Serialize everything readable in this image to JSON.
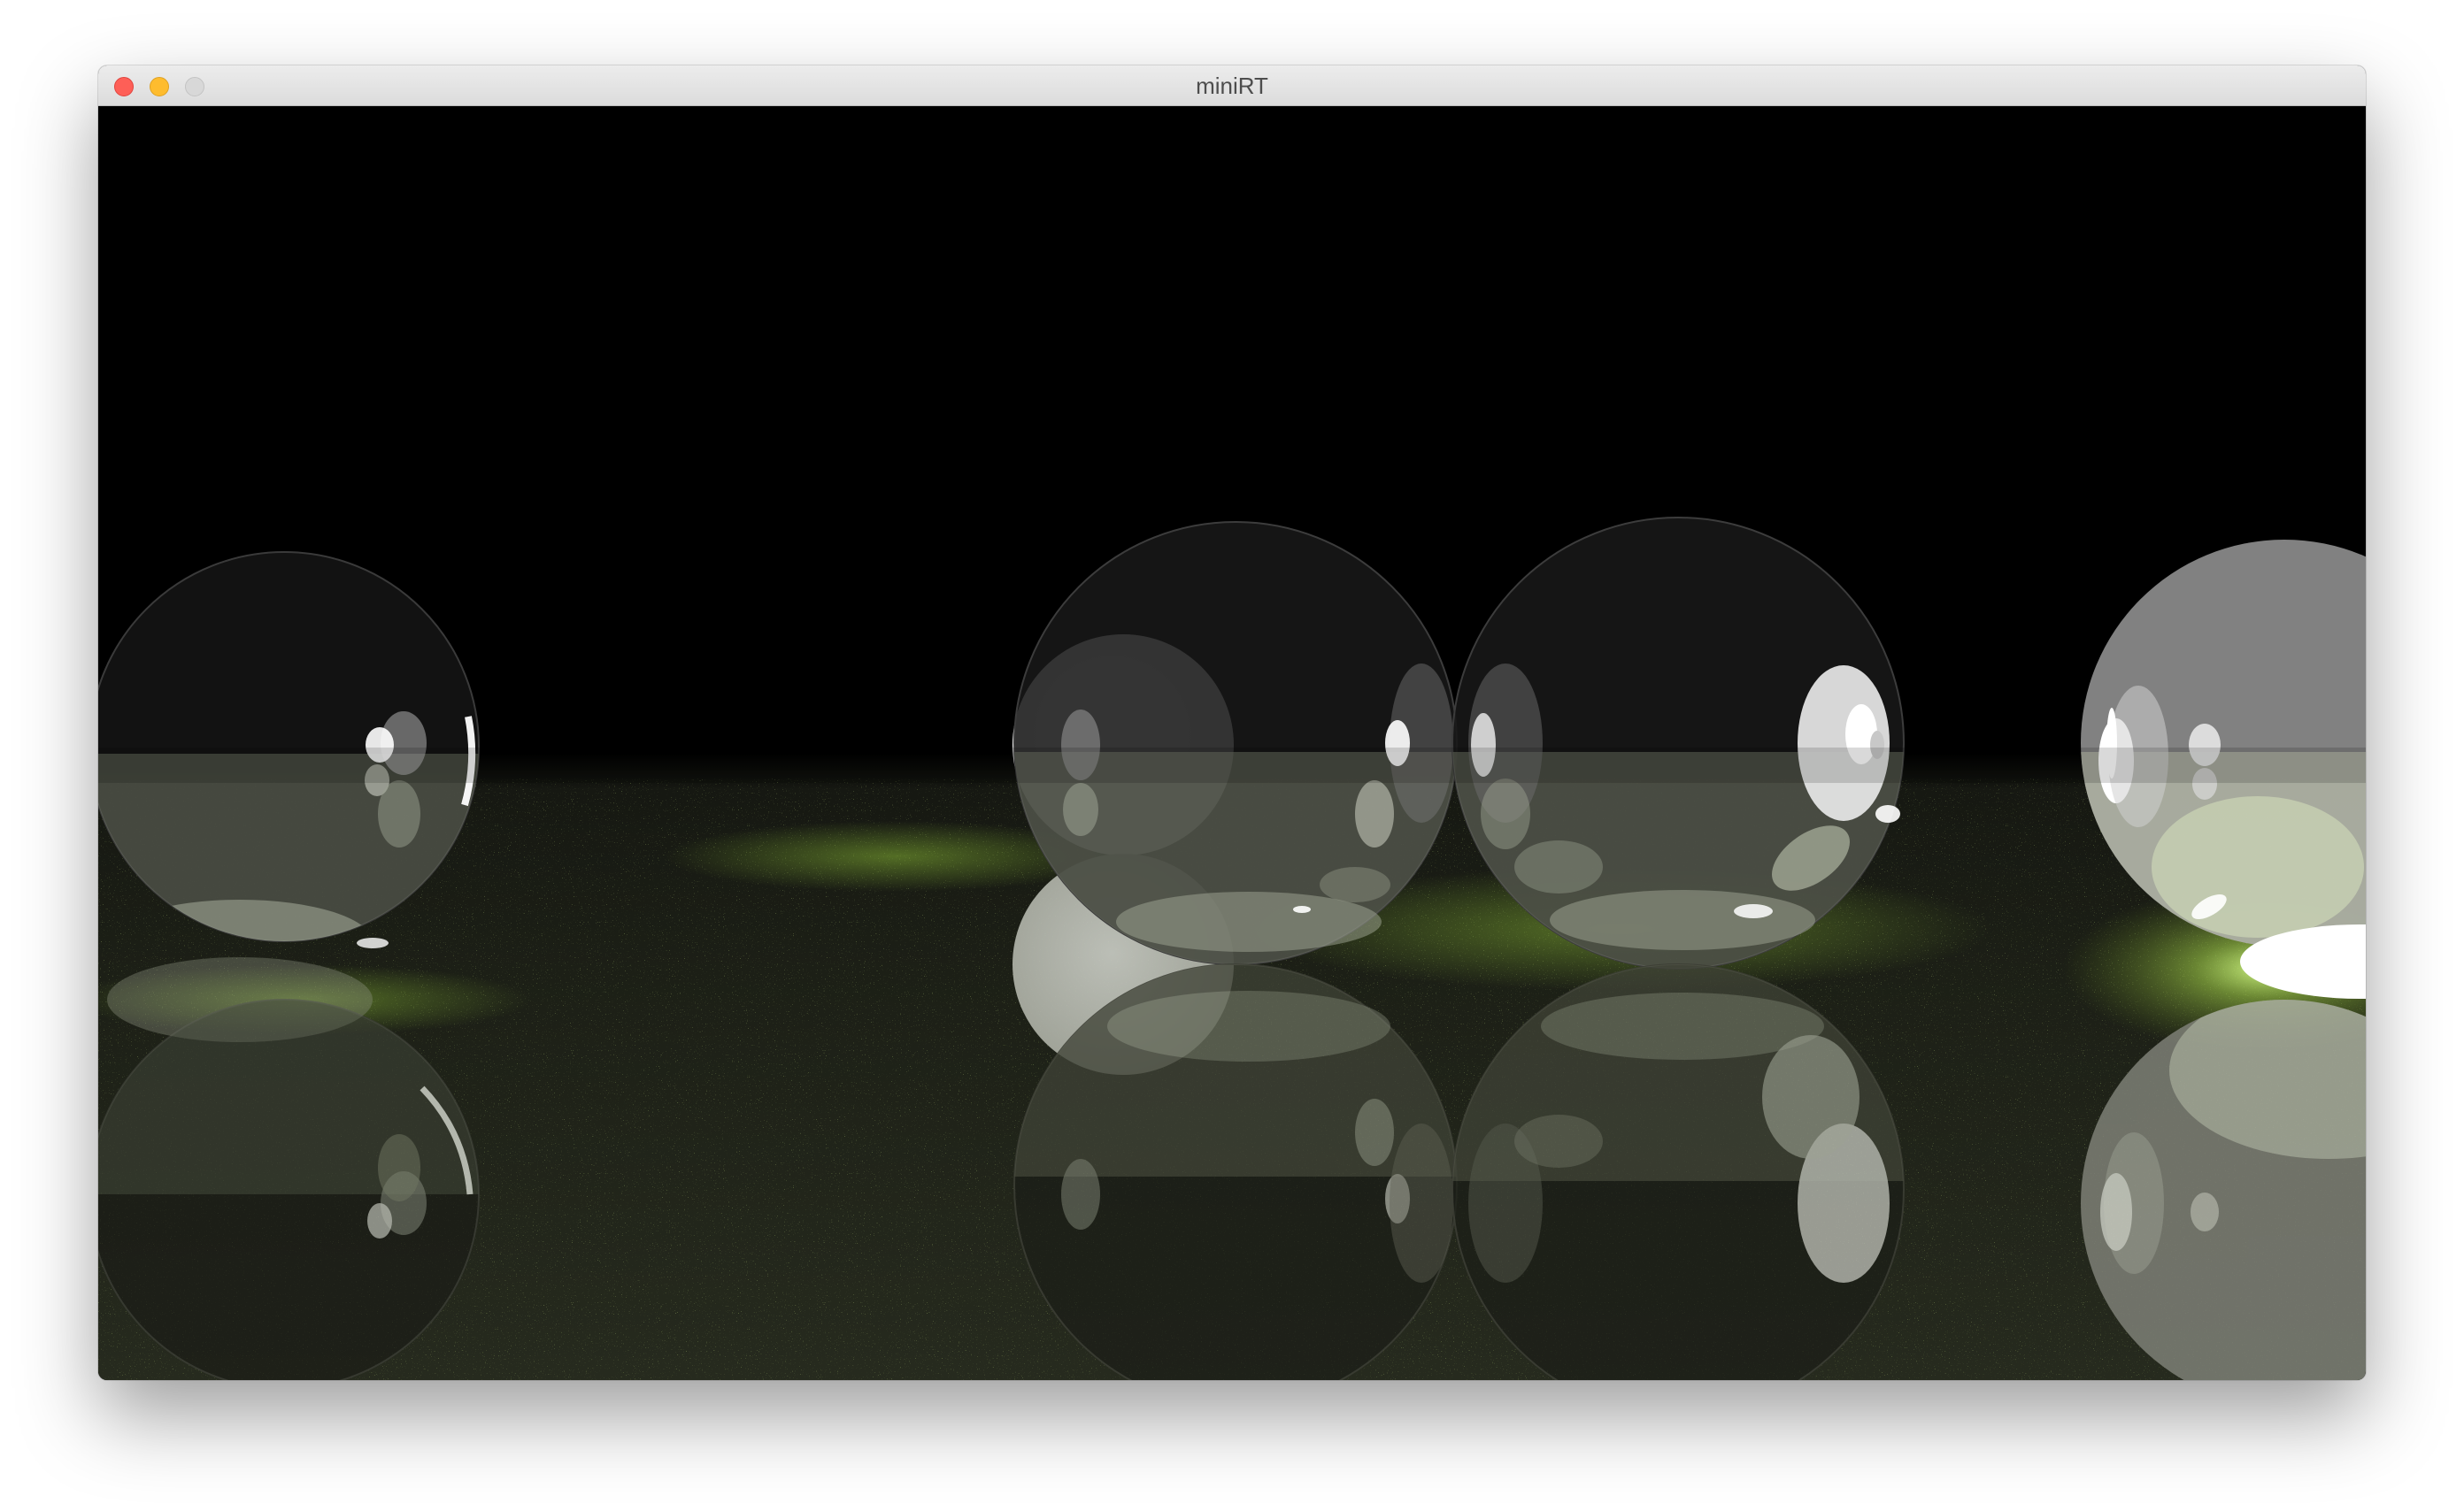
{
  "window": {
    "title": "miniRT",
    "buttons": {
      "close": "close-button",
      "minimize": "minimize-button",
      "zoom": "zoom-button"
    }
  },
  "scene": {
    "description_colors": {
      "background": "#000000",
      "floor": "#23261b",
      "speckle": "#9bd23a",
      "glass": "#a0a89a"
    }
  }
}
